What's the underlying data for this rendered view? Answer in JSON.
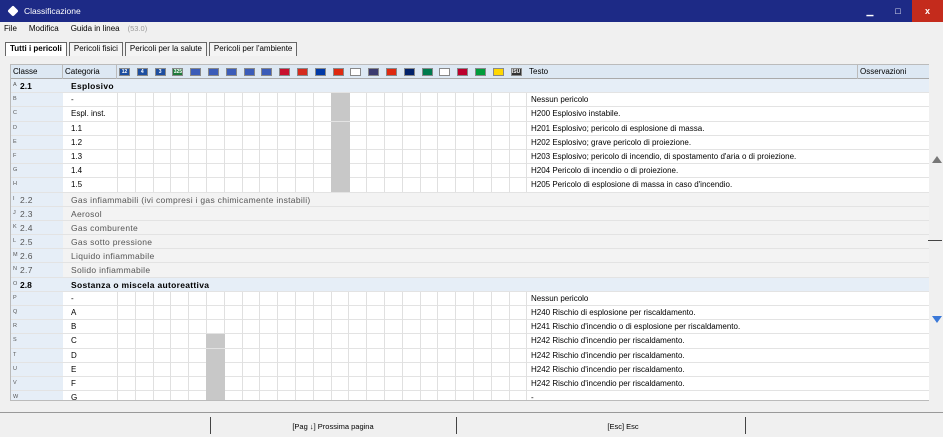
{
  "window": {
    "title": "Classificazione"
  },
  "menu": {
    "items": [
      "File",
      "Modifica",
      "Guida in linea"
    ],
    "version": "(53.0)"
  },
  "tabs": [
    "Tutti i pericoli",
    "Pericoli fisici",
    "Pericoli per la salute",
    "Pericoli per l'ambiente"
  ],
  "table": {
    "headers": {
      "classe": "Classe",
      "categoria": "Categoria",
      "testo": "Testo",
      "osservazioni": "Osservazioni"
    },
    "flags": [
      "12",
      "4",
      "3",
      "325",
      "…",
      "…",
      "…",
      "…",
      "…",
      "…",
      "…",
      "…",
      "…",
      "…",
      "…",
      "…",
      "…",
      "…",
      "…",
      "…",
      "…",
      "…",
      "ISU"
    ],
    "rows": [
      {
        "letter": "A",
        "classe": "2.1",
        "cat": "Esplosivo",
        "testo": "",
        "type": "group"
      },
      {
        "letter": "B",
        "classe": "",
        "cat": "-",
        "testo": "Nessun pericolo",
        "type": "item",
        "shade": 12
      },
      {
        "letter": "C",
        "classe": "",
        "cat": "Espl. inst.",
        "testo": "H200 Esplosivo instabile.",
        "type": "item",
        "shade": 12
      },
      {
        "letter": "D",
        "classe": "",
        "cat": "1.1",
        "testo": "H201 Esplosivo; pericolo di esplosione di massa.",
        "type": "item",
        "shade": 12
      },
      {
        "letter": "E",
        "classe": "",
        "cat": "1.2",
        "testo": "H202 Esplosivo; grave pericolo di proiezione.",
        "type": "item",
        "shade": 12
      },
      {
        "letter": "F",
        "classe": "",
        "cat": "1.3",
        "testo": "H203 Esplosivo; pericolo di incendio, di spostamento d'aria o di proiezione.",
        "type": "item",
        "shade": 12
      },
      {
        "letter": "G",
        "classe": "",
        "cat": "1.4",
        "testo": "H204 Pericolo di incendio o di proiezione.",
        "type": "item",
        "shade": 12
      },
      {
        "letter": "H",
        "classe": "",
        "cat": "1.5",
        "testo": "H205 Pericolo di esplosione di massa in caso d'incendio.",
        "type": "item",
        "shade": 12
      },
      {
        "letter": "I",
        "classe": "2.2",
        "cat": "Gas infiammabili (ivi compresi i gas chimicamente instabili)",
        "testo": "",
        "type": "subgroup"
      },
      {
        "letter": "J",
        "classe": "2.3",
        "cat": "Aerosol",
        "testo": "",
        "type": "subgroup"
      },
      {
        "letter": "K",
        "classe": "2.4",
        "cat": "Gas comburente",
        "testo": "",
        "type": "subgroup"
      },
      {
        "letter": "L",
        "classe": "2.5",
        "cat": "Gas sotto pressione",
        "testo": "",
        "type": "subgroup"
      },
      {
        "letter": "M",
        "classe": "2.6",
        "cat": "Liquido infiammabile",
        "testo": "",
        "type": "subgroup"
      },
      {
        "letter": "N",
        "classe": "2.7",
        "cat": "Solido infiammabile",
        "testo": "",
        "type": "subgroup"
      },
      {
        "letter": "O",
        "classe": "2.8",
        "cat": "Sostanza o miscela autoreattiva",
        "testo": "",
        "type": "group"
      },
      {
        "letter": "P",
        "classe": "",
        "cat": "-",
        "testo": "Nessun pericolo",
        "type": "item"
      },
      {
        "letter": "Q",
        "classe": "",
        "cat": "A",
        "testo": "H240 Rischio di esplosione per riscaldamento.",
        "type": "item"
      },
      {
        "letter": "R",
        "classe": "",
        "cat": "B",
        "testo": "H241 Rischio d'incendio o di esplosione per riscaldamento.",
        "type": "item"
      },
      {
        "letter": "S",
        "classe": "",
        "cat": "C",
        "testo": "H242 Rischio d'incendio per riscaldamento.",
        "type": "item",
        "shade": 5
      },
      {
        "letter": "T",
        "classe": "",
        "cat": "D",
        "testo": "H242 Rischio d'incendio per riscaldamento.",
        "type": "item",
        "shade": 5
      },
      {
        "letter": "U",
        "classe": "",
        "cat": "E",
        "testo": "H242 Rischio d'incendio per riscaldamento.",
        "type": "item",
        "shade": 5
      },
      {
        "letter": "V",
        "classe": "",
        "cat": "F",
        "testo": "H242 Rischio d'incendio per riscaldamento.",
        "type": "item",
        "shade": 5
      },
      {
        "letter": "W",
        "classe": "",
        "cat": "G",
        "testo": "-",
        "type": "item",
        "shade": 5
      }
    ]
  },
  "bottom": {
    "next_page": "[Pag ↓] Prossima pagina",
    "esc": "[Esc] Esc"
  },
  "colors": {
    "titlebar": "#1d2a86",
    "close": "#c42b1c",
    "header": "#dde8f3"
  }
}
